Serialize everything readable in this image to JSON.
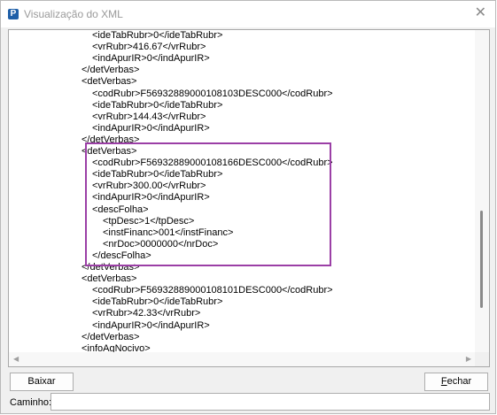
{
  "window": {
    "title": "Visualização do XML",
    "icon": "P"
  },
  "xml": {
    "lines": [
      "<ideTabRubr>0</ideTabRubr>",
      "<vrRubr>416.67</vrRubr>",
      "<indApurIR>0</indApurIR>",
      "</detVerbas>",
      "<detVerbas>",
      "<codRubr>F56932889000108103DESC000</codRubr>",
      "<ideTabRubr>0</ideTabRubr>",
      "<vrRubr>144.43</vrRubr>",
      "<indApurIR>0</indApurIR>",
      "</detVerbas>",
      "<detVerbas>",
      "<codRubr>F56932889000108166DESC000</codRubr>",
      "<ideTabRubr>0</ideTabRubr>",
      "<vrRubr>300.00</vrRubr>",
      "<indApurIR>0</indApurIR>",
      "<descFolha>",
      "<tpDesc>1</tpDesc>",
      "<instFinanc>001</instFinanc>",
      "<nrDoc>0000000</nrDoc>",
      "</descFolha>",
      "</detVerbas>",
      "<detVerbas>",
      "<codRubr>F56932889000108101DESC000</codRubr>",
      "<ideTabRubr>0</ideTabRubr>",
      "<vrRubr>42.33</vrRubr>",
      "<indApurIR>0</indApurIR>",
      "</detVerbas>",
      "<infoAgNocivo>"
    ]
  },
  "buttons": {
    "download": "Baixar",
    "close": "Fechar"
  },
  "path": {
    "label": "Caminho:",
    "value": ""
  }
}
